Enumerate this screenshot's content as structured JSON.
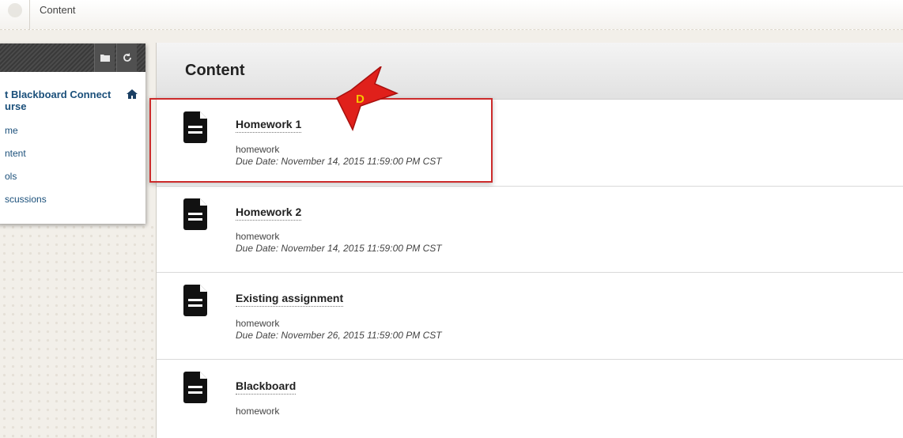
{
  "breadcrumb": {
    "current": "Content"
  },
  "course_menu": {
    "title": "t Blackboard Connect\nurse",
    "items": [
      {
        "label": "me"
      },
      {
        "label": "ntent"
      },
      {
        "label": "ols"
      },
      {
        "label": "scussions"
      }
    ]
  },
  "page": {
    "title": "Content"
  },
  "items": [
    {
      "title": "Homework 1",
      "description": "homework",
      "due": "Due Date: November 14, 2015 11:59:00 PM CST"
    },
    {
      "title": "Homework 2",
      "description": "homework",
      "due": "Due Date: November 14, 2015 11:59:00 PM CST"
    },
    {
      "title": "Existing assignment",
      "description": "homework",
      "due": "Due Date: November 26, 2015 11:59:00 PM CST"
    },
    {
      "title": "Blackboard",
      "description": "homework"
    }
  ],
  "annotation": {
    "label": "D",
    "color": "#e0201b",
    "label_color": "#f5c400"
  },
  "icons": {
    "folder": "folder-icon",
    "refresh": "refresh-icon",
    "home": "home-icon",
    "document": "document-icon"
  }
}
